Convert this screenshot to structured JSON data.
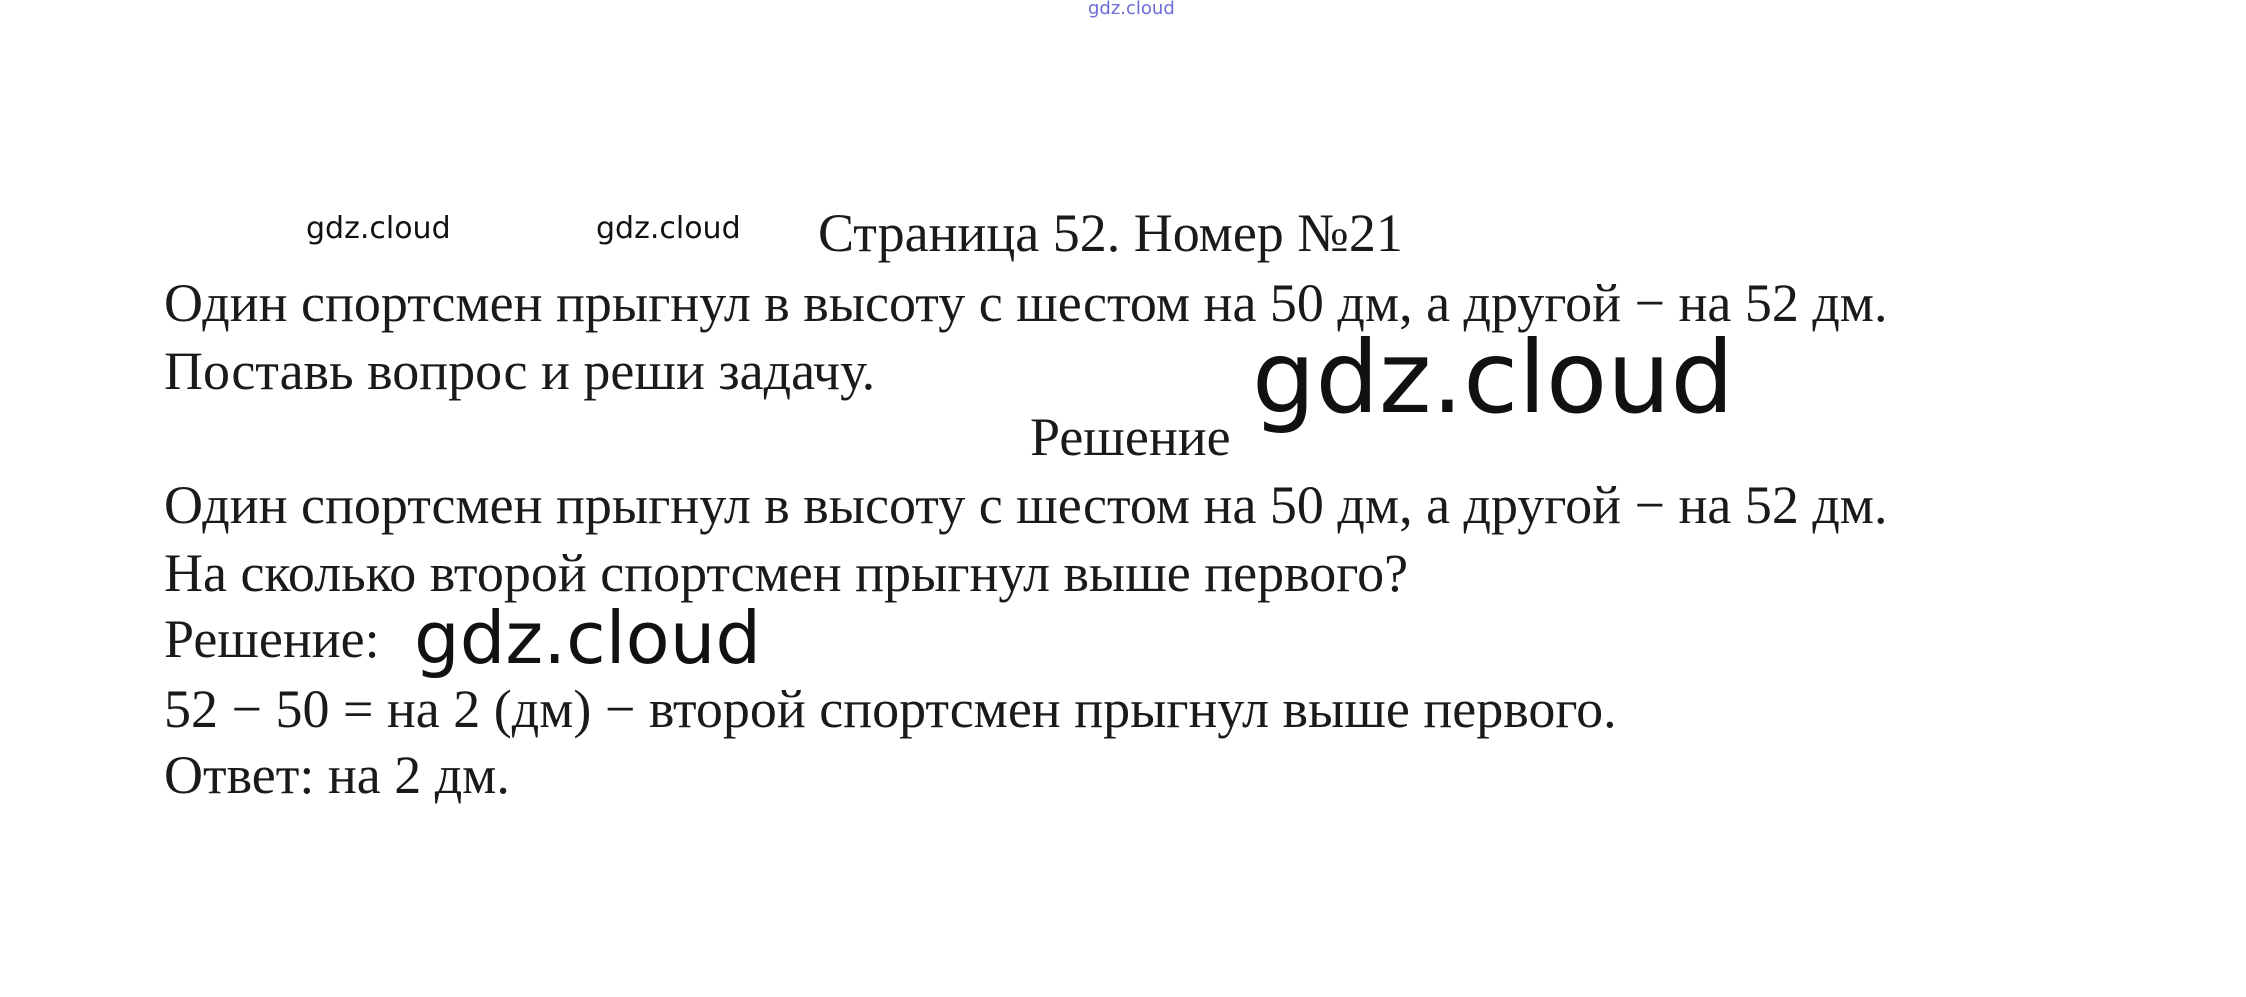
{
  "watermarks": {
    "top": "gdz.cloud",
    "small_1": "gdz.cloud",
    "small_2": "gdz.cloud",
    "big": "gdz.cloud",
    "mid": "gdz.cloud"
  },
  "document": {
    "title": "Страница 52. Номер №21",
    "task_line_1": "Один спортсмен прыгнул в высоту с шестом на 50 дм, а другой − на 52 дм.",
    "task_line_2": "Поставь вопрос и реши задачу.",
    "solution_heading": "Решение",
    "solution_line_1": "Один спортсмен прыгнул в высоту с шестом на 50 дм, а другой − на 52 дм.",
    "solution_line_2": "На сколько второй спортсмен прыгнул выше первого?",
    "solution_label": "Решение:",
    "calculation": "52 − 50 = на 2 (дм) − второй спортсмен прыгнул выше первого.",
    "answer": "Ответ: на 2 дм."
  }
}
